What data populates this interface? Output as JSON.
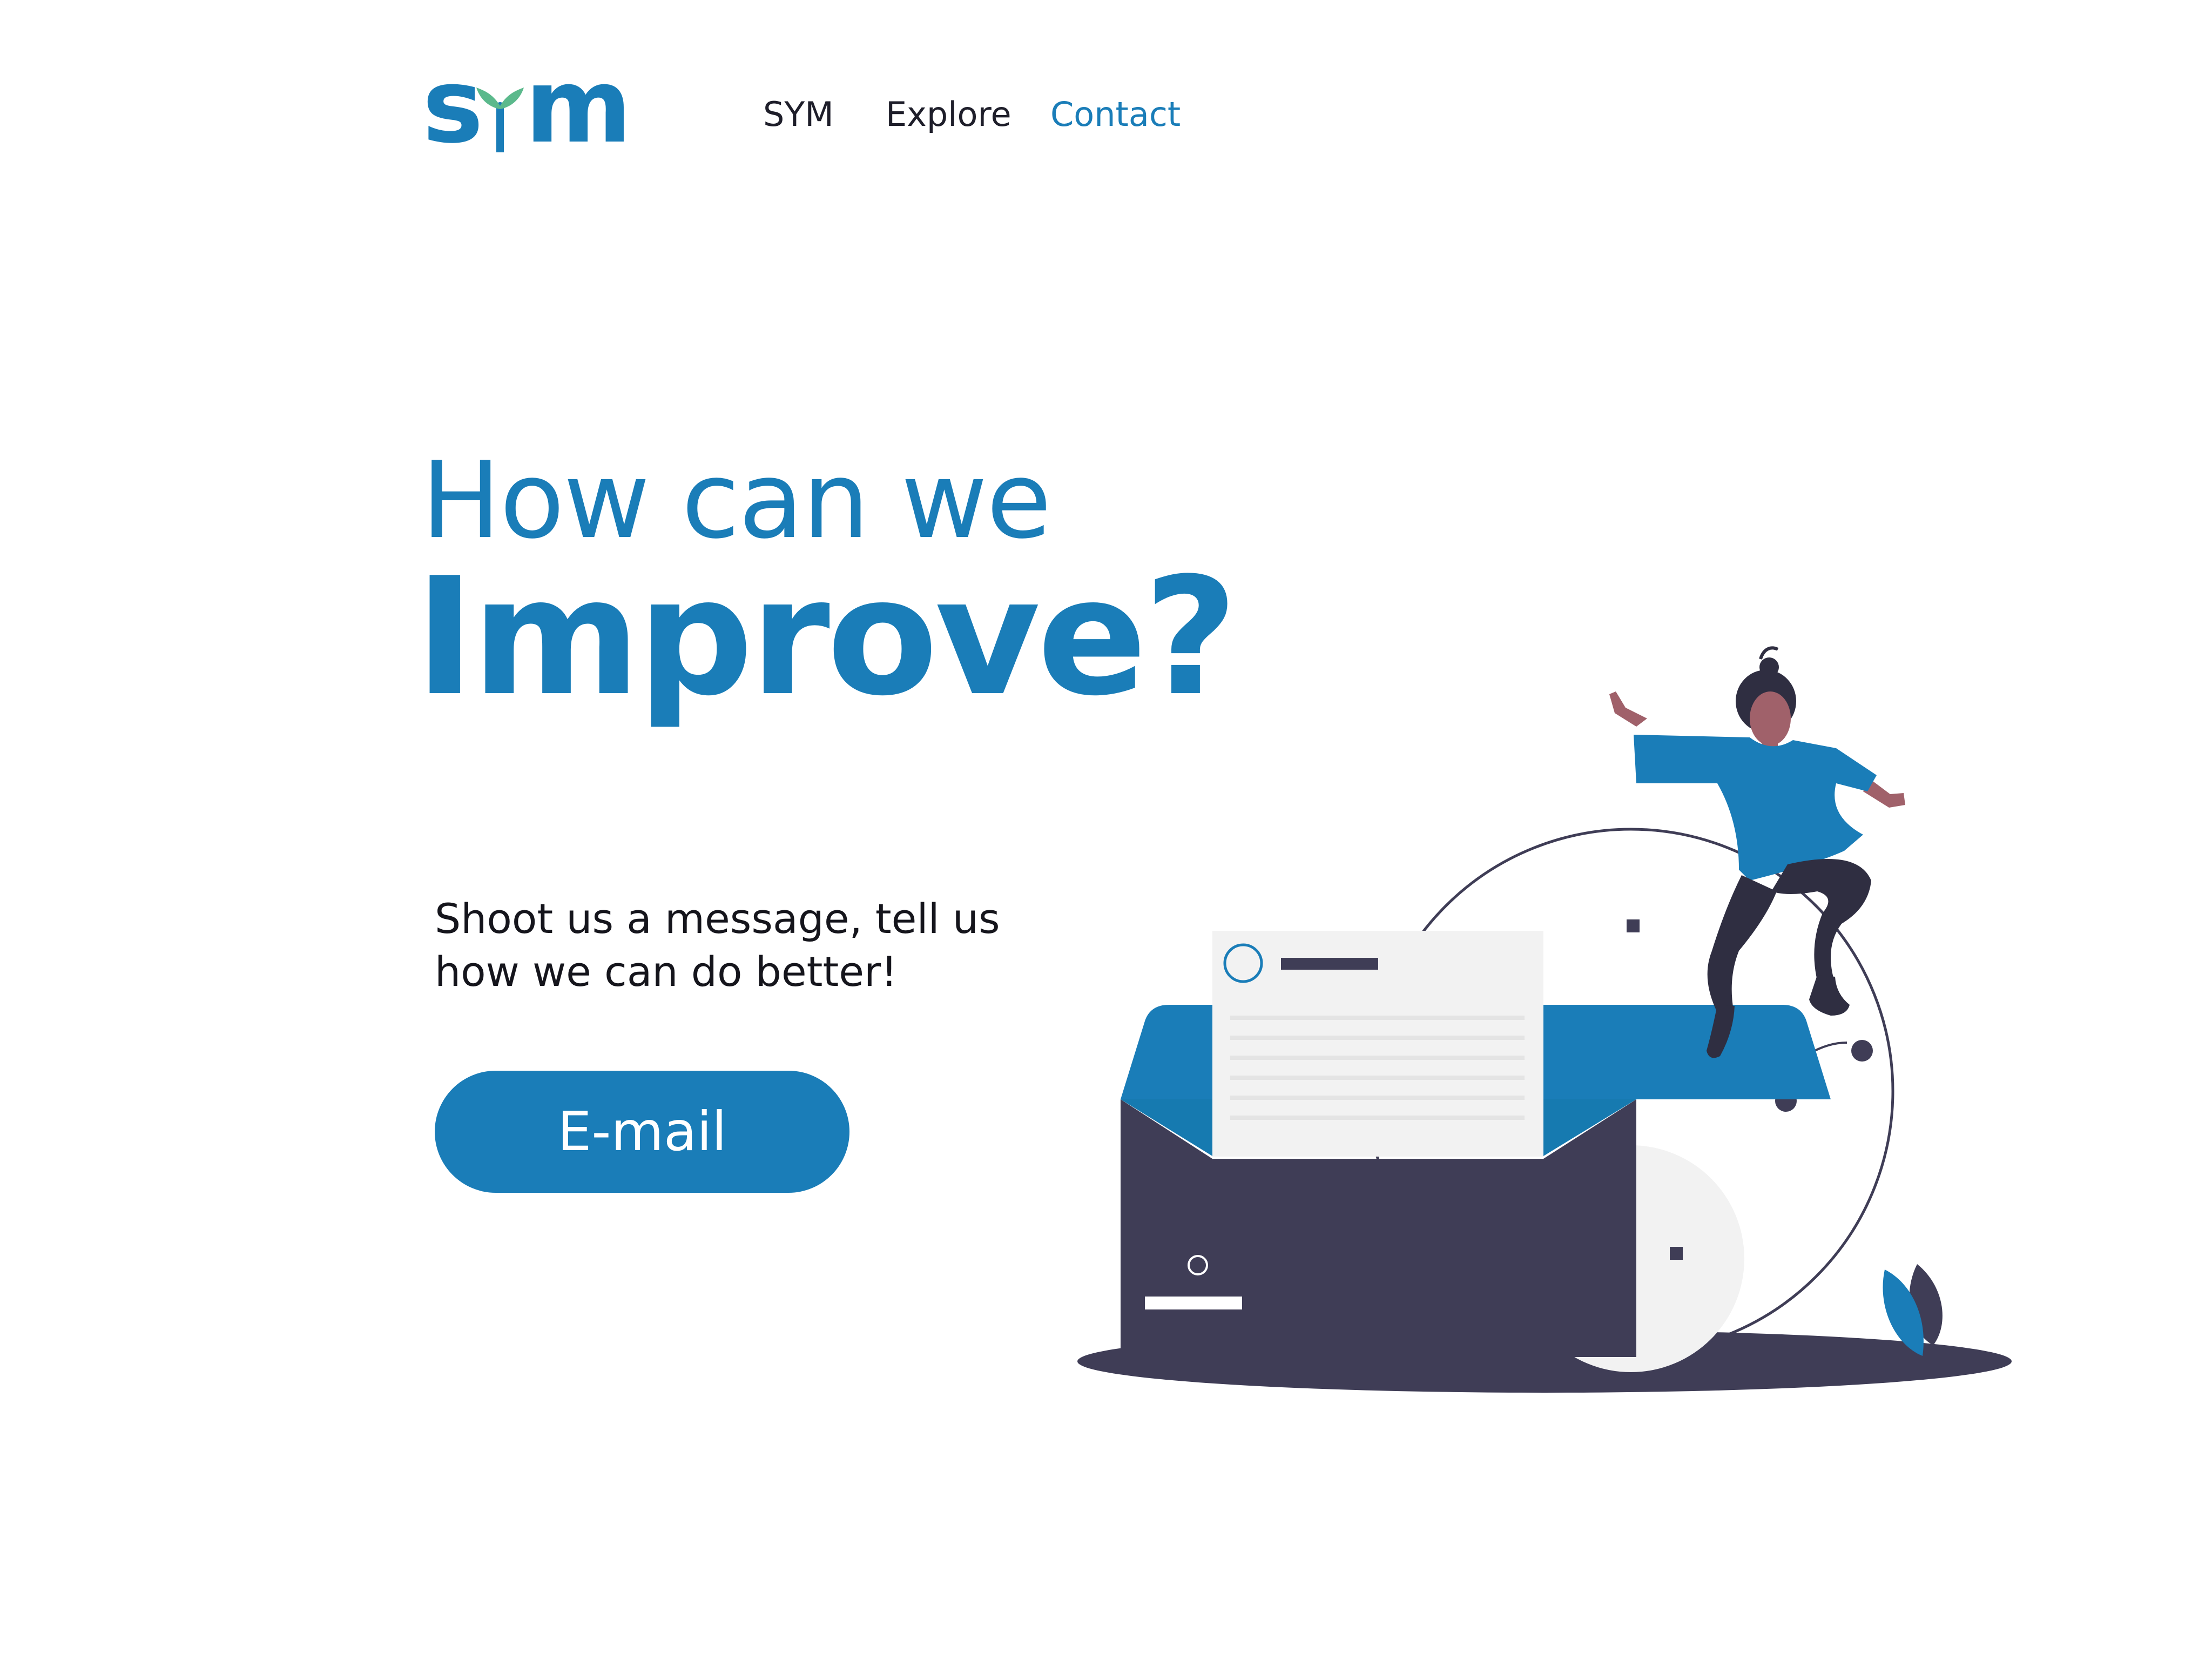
{
  "brand": {
    "logo_text": "sym",
    "accent_color": "#1a7db8",
    "leaf_color": "#5bb98c"
  },
  "nav": {
    "items": [
      {
        "label": "SYM",
        "active": false
      },
      {
        "label": "Explore",
        "active": false
      },
      {
        "label": "Contact",
        "active": true
      }
    ]
  },
  "hero": {
    "headline_line1": "How can we",
    "headline_line2": "Improve?",
    "subtext_line1": "Shoot us a message, tell us",
    "subtext_line2": "how we can do better!",
    "cta_label": "E-mail"
  },
  "colors": {
    "primary": "#1a7db8",
    "text": "#15151c",
    "dark": "#3f3d56",
    "paper": "#f2f2f2",
    "skin": "#a0616a"
  }
}
